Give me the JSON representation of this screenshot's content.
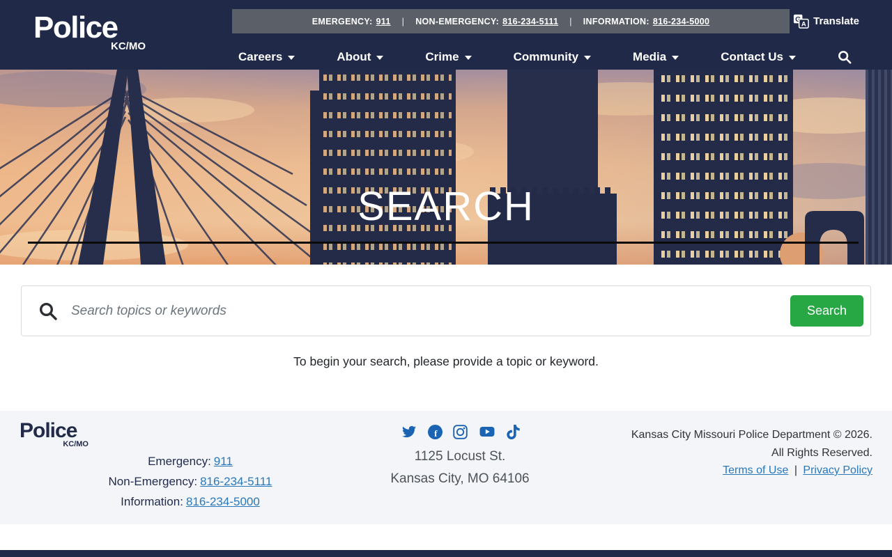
{
  "topbar": {
    "items": [
      {
        "label": "EMERGENCY:",
        "value": "911"
      },
      {
        "label": "NON-EMERGENCY:",
        "value": "816-234-5111"
      },
      {
        "label": "INFORMATION:",
        "value": "816-234-5000"
      }
    ],
    "separator": "|",
    "translate_label": "Translate"
  },
  "header": {
    "logo": {
      "title": "Police",
      "subtitle": "KC/MO"
    },
    "nav": [
      {
        "label": "Careers"
      },
      {
        "label": "About"
      },
      {
        "label": "Crime"
      },
      {
        "label": "Community"
      },
      {
        "label": "Media"
      },
      {
        "label": "Contact Us"
      }
    ]
  },
  "hero": {
    "title": "SEARCH"
  },
  "search": {
    "placeholder": "Search topics or keywords",
    "button_label": "Search",
    "help_text": "To begin your search, please provide a topic or keyword."
  },
  "footer": {
    "logo": {
      "title": "Police",
      "subtitle": "KC/MO"
    },
    "contacts": [
      {
        "label": "Emergency:",
        "value": "911"
      },
      {
        "label": "Non-Emergency:",
        "value": "816-234-5111"
      },
      {
        "label": "Information:",
        "value": "816-234-5000"
      }
    ],
    "social": [
      {
        "name": "twitter"
      },
      {
        "name": "facebook"
      },
      {
        "name": "instagram"
      },
      {
        "name": "youtube"
      },
      {
        "name": "tiktok"
      }
    ],
    "address_line1": "1125 Locust St.",
    "address_line2": "Kansas City, MO 64106",
    "copyright_line1": "Kansas City Missouri Police Department © 2026.",
    "copyright_line2": "All Rights Reserved.",
    "links": [
      {
        "label": "Terms of Use"
      },
      {
        "label": "Privacy Policy"
      }
    ],
    "links_separator": "|"
  },
  "colors": {
    "navy": "#202a48",
    "topbar_gray": "#5b5f68",
    "accent_green": "#28a745",
    "link_blue": "#2a78ba",
    "social_blue": "#1b64b3",
    "footer_bg": "#f4f5f8"
  }
}
